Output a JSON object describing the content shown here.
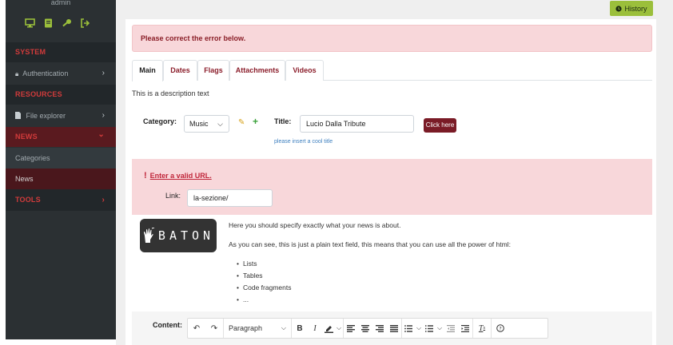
{
  "sidebar": {
    "user": "admin",
    "top_icons": [
      "monitor-icon",
      "book-icon",
      "key-icon",
      "sign-out-icon"
    ],
    "sections": {
      "system": "SYSTEM",
      "authentication": "Authentication",
      "resources": "RESOURCES",
      "file_explorer": "File explorer",
      "news": "NEWS",
      "categories": "Categories",
      "news_item": "News",
      "tools": "TOOLS"
    },
    "chevron_right": "›",
    "chevron_down": "⌄"
  },
  "header": {
    "history_label": "History"
  },
  "alert": {
    "message": "Please correct the error below."
  },
  "tabs": [
    "Main",
    "Dates",
    "Flags",
    "Attachments",
    "Videos"
  ],
  "form": {
    "description": "This is a description text",
    "category_label": "Category:",
    "category_value": "Music",
    "title_label": "Title:",
    "title_value": "Lucio Dalla Tribute",
    "click_here": "Click here",
    "title_help": "please insert a cool title",
    "link_error": "Enter a valid URL.",
    "link_label": "Link:",
    "link_value": "la-sezione/",
    "content_label": "Content:"
  },
  "about": {
    "logo_text": "BATON",
    "line1": "Here you should specify exactly what your news is about.",
    "line2": "As you can see, this is just a plain text field, this means that you can use all the power of html:",
    "bullets": [
      "Lists",
      "Tables",
      "Code fragments",
      "..."
    ]
  },
  "toolbar": {
    "paragraph": "Paragraph"
  },
  "colors": {
    "sidebar_bg": "#2b3033",
    "accent_red": "#d13b3b",
    "active_item_bg": "#5a1a1f",
    "history_btn": "#9bbf3b",
    "alert_bg": "#f8d7da",
    "primary_btn": "#7a1b26"
  }
}
